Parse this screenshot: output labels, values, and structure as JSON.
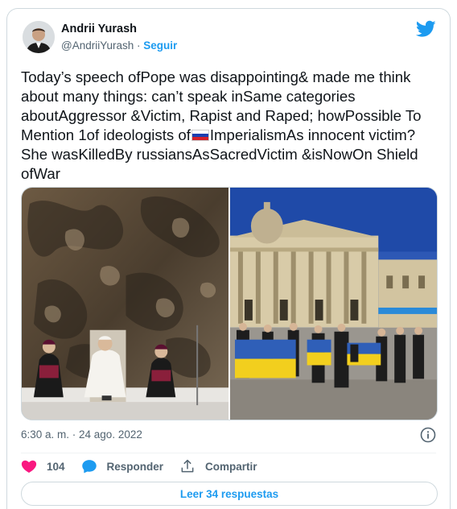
{
  "author": {
    "name": "Andrii Yurash",
    "handle": "@AndriiYurash",
    "separator": " · ",
    "follow_label": "Seguir"
  },
  "tweet": {
    "text_before_flag": "Today’s speech ofPope was disappointing& made me think about many things: can’t speak inSame categories aboutAggressor &Victim, Rapist and Raped; howPossible To Mention 1of ideologists of",
    "flag_icon": "russian-flag",
    "text_after_flag": "ImperialismAs innocent victim? She wasKilledBy russiansAsSacredVictim &isNowOn Shield ofWar"
  },
  "meta": {
    "timestamp": "6:30 a. m. · 24 ago. 2022"
  },
  "actions": {
    "like_count": "104",
    "reply_label": "Responder",
    "share_label": "Compartir"
  },
  "replies_button": "Leer 34 respuestas",
  "colors": {
    "accent": "#1d9bf0",
    "like": "#f91880",
    "text": "#0f1419",
    "muted": "#536471",
    "border": "#cfd9de"
  }
}
